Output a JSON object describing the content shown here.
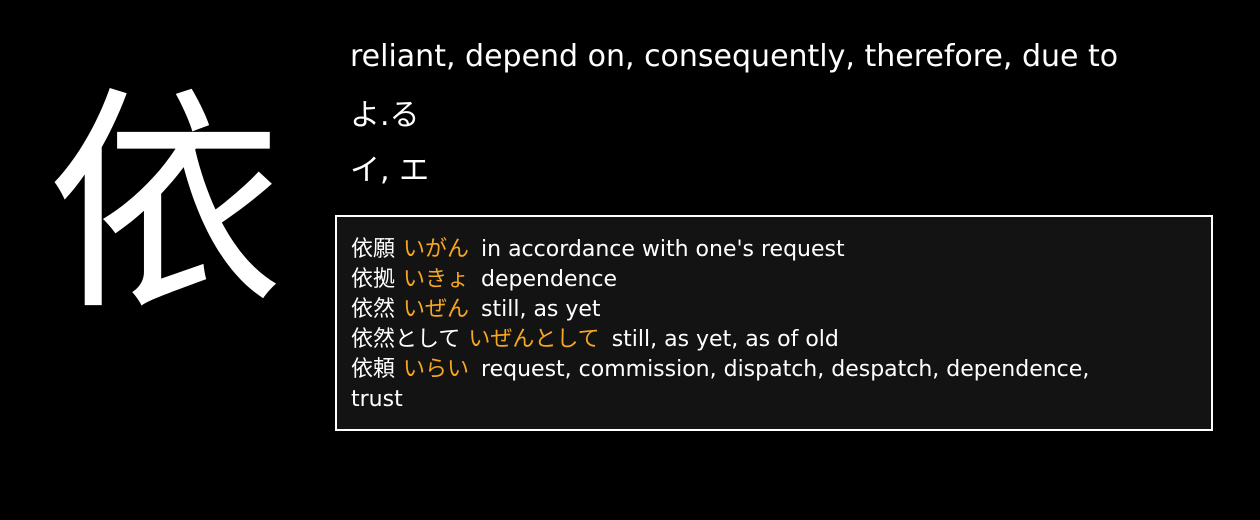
{
  "kanji": "依",
  "meaning": "reliant, depend on, consequently, therefore, due to",
  "kun_reading": "よ.る",
  "on_reading": "イ, エ",
  "colors": {
    "background": "#000000",
    "reading_accent": "#f5a623",
    "box_background": "#131313",
    "box_border": "#ffffff"
  },
  "vocabulary": [
    {
      "word": "依願",
      "reading": "いがん",
      "gloss": "in accordance with one's request"
    },
    {
      "word": "依拠",
      "reading": "いきょ",
      "gloss": "dependence"
    },
    {
      "word": "依然",
      "reading": "いぜん",
      "gloss": "still, as yet"
    },
    {
      "word": "依然として",
      "reading": "いぜんとして",
      "gloss": "still, as yet, as of old"
    },
    {
      "word": "依頼",
      "reading": "いらい",
      "gloss": "request, commission, dispatch, despatch, dependence, trust"
    }
  ]
}
